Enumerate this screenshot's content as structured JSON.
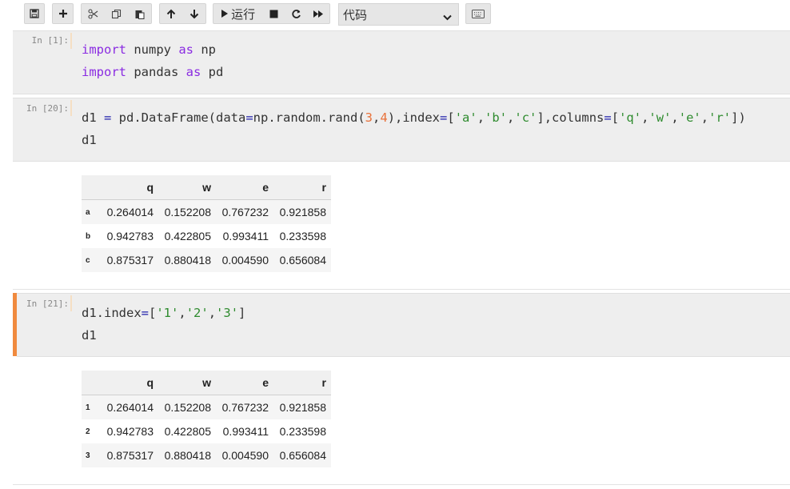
{
  "toolbar": {
    "run_label": "运行",
    "cell_type": "代码",
    "icons": [
      "save-icon",
      "plus-icon",
      "cut-icon",
      "copy-icon",
      "paste-icon",
      "arrow-up-icon",
      "arrow-down-icon",
      "run-icon",
      "stop-icon",
      "restart-icon",
      "fast-forward-icon",
      "keyboard-icon"
    ]
  },
  "cells": [
    {
      "prompt": "In [1]:",
      "code": [
        "import numpy as np",
        "import pandas as pd"
      ]
    },
    {
      "prompt": "In [20]:",
      "code": [
        "d1 = pd.DataFrame(data=np.random.rand(3,4),index=['a','b','c'],columns=['q','w','e','r'])",
        "d1"
      ],
      "output": {
        "columns": [
          "q",
          "w",
          "e",
          "r"
        ],
        "rows": [
          {
            "index": "a",
            "values": [
              "0.264014",
              "0.152208",
              "0.767232",
              "0.921858"
            ]
          },
          {
            "index": "b",
            "values": [
              "0.942783",
              "0.422805",
              "0.993411",
              "0.233598"
            ]
          },
          {
            "index": "c",
            "values": [
              "0.875317",
              "0.880418",
              "0.004590",
              "0.656084"
            ]
          }
        ]
      }
    },
    {
      "prompt": "In [21]:",
      "code": [
        "d1.index=['1','2','3']",
        "d1"
      ],
      "output": {
        "columns": [
          "q",
          "w",
          "e",
          "r"
        ],
        "rows": [
          {
            "index": "1",
            "values": [
              "0.264014",
              "0.152208",
              "0.767232",
              "0.921858"
            ]
          },
          {
            "index": "2",
            "values": [
              "0.942783",
              "0.422805",
              "0.993411",
              "0.233598"
            ]
          },
          {
            "index": "3",
            "values": [
              "0.875317",
              "0.880418",
              "0.004590",
              "0.656084"
            ]
          }
        ]
      }
    }
  ],
  "colors": {
    "selected_cell_border": "#f08a3e",
    "keyword": "#8a2be2",
    "string": "#2e8b2e",
    "number": "#e8713a"
  }
}
